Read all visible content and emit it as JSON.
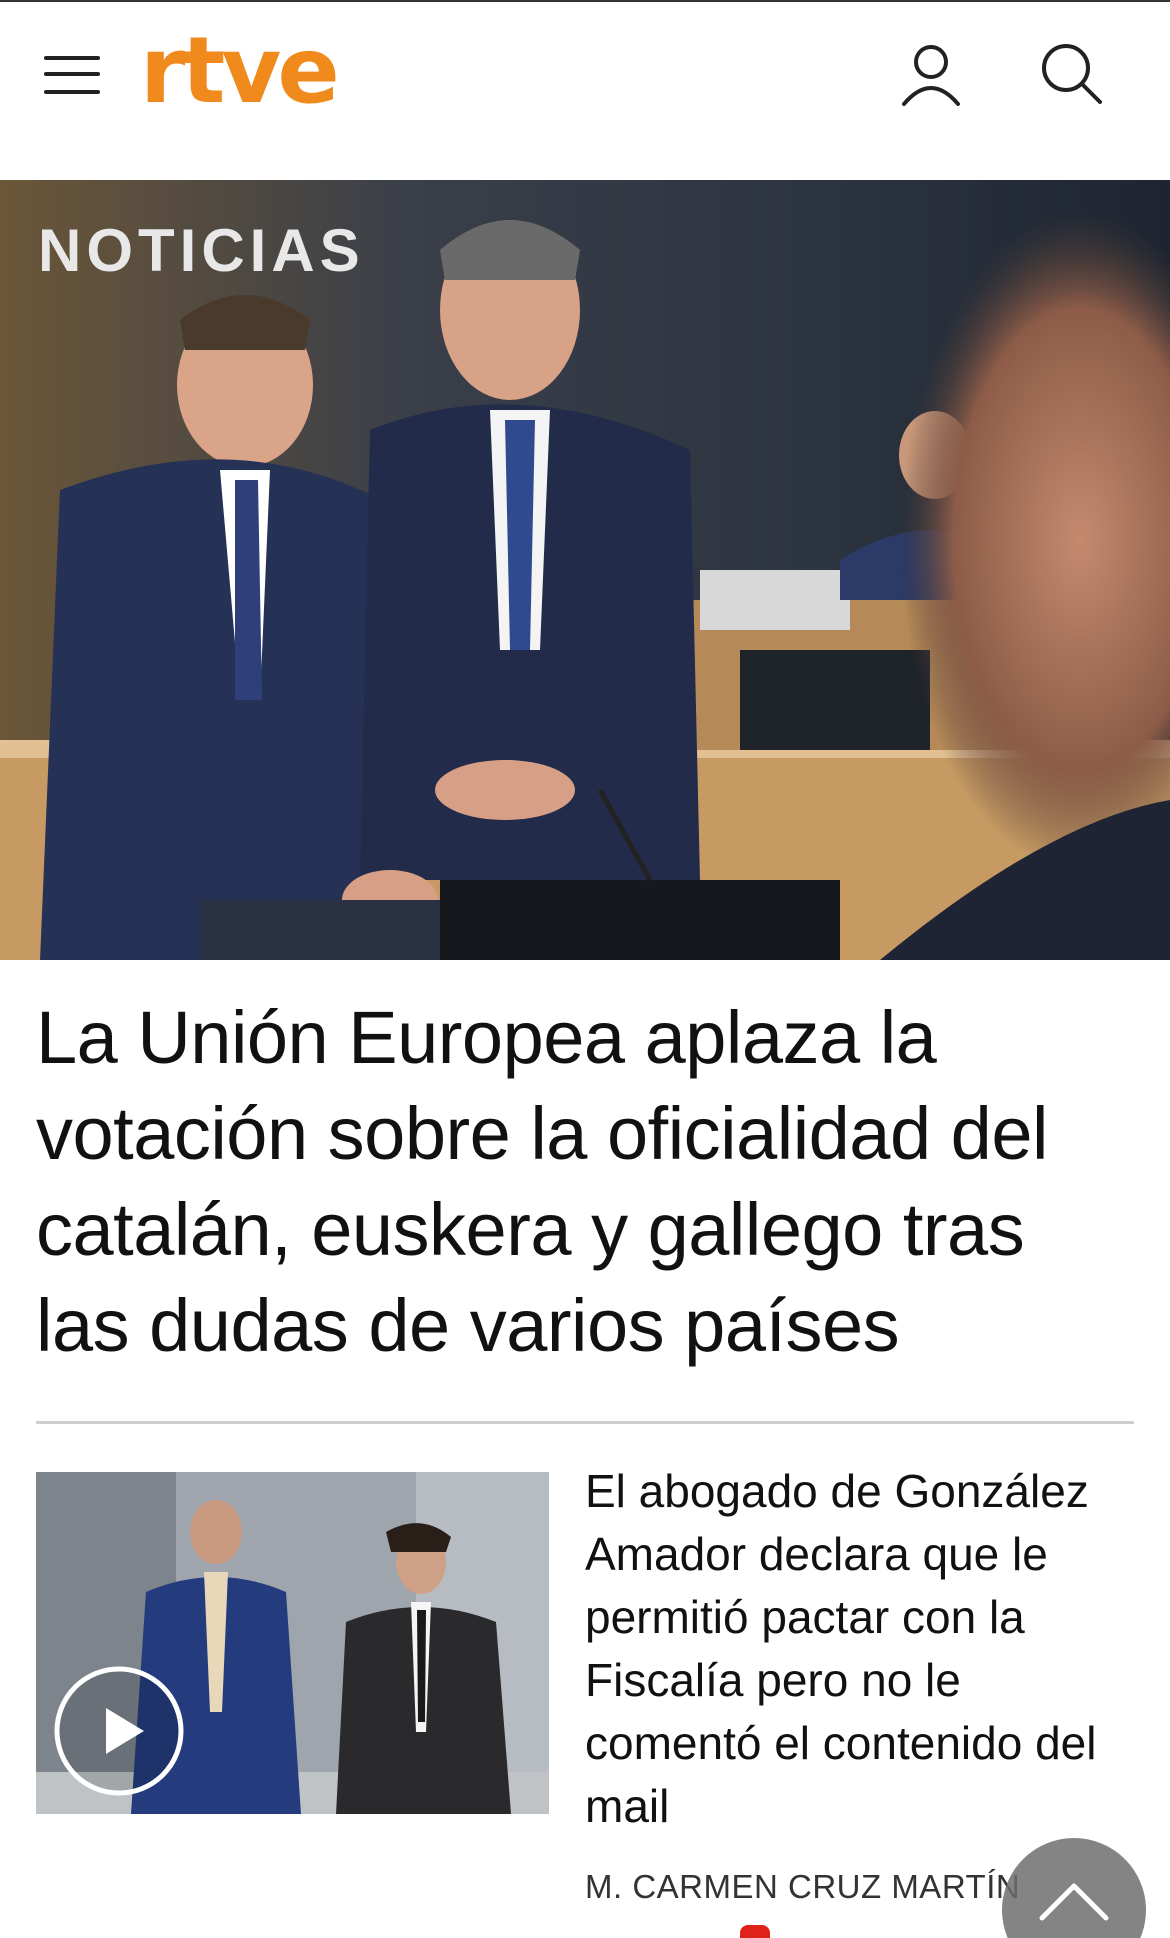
{
  "header": {
    "logo_text": "rtve",
    "menu_icon": "hamburger-menu-icon",
    "user_icon": "user-icon",
    "search_icon": "search-icon",
    "brand_color": "#f08a1c"
  },
  "hero": {
    "section_label": "NOTICIAS",
    "headline": "La Unión Europea aplaza la votación sobre la oficialidad del catalán, euskera y gallego tras las dudas de varios países"
  },
  "article2": {
    "title": "El abogado de González Amador declara que le permitió pactar con la Fiscalía pero no le comentó el contenido del mail",
    "author": "M. CARMEN CRUZ MARTÍN",
    "media_icon": "play-icon"
  },
  "floating": {
    "scroll_top_icon": "chevron-up-icon"
  }
}
